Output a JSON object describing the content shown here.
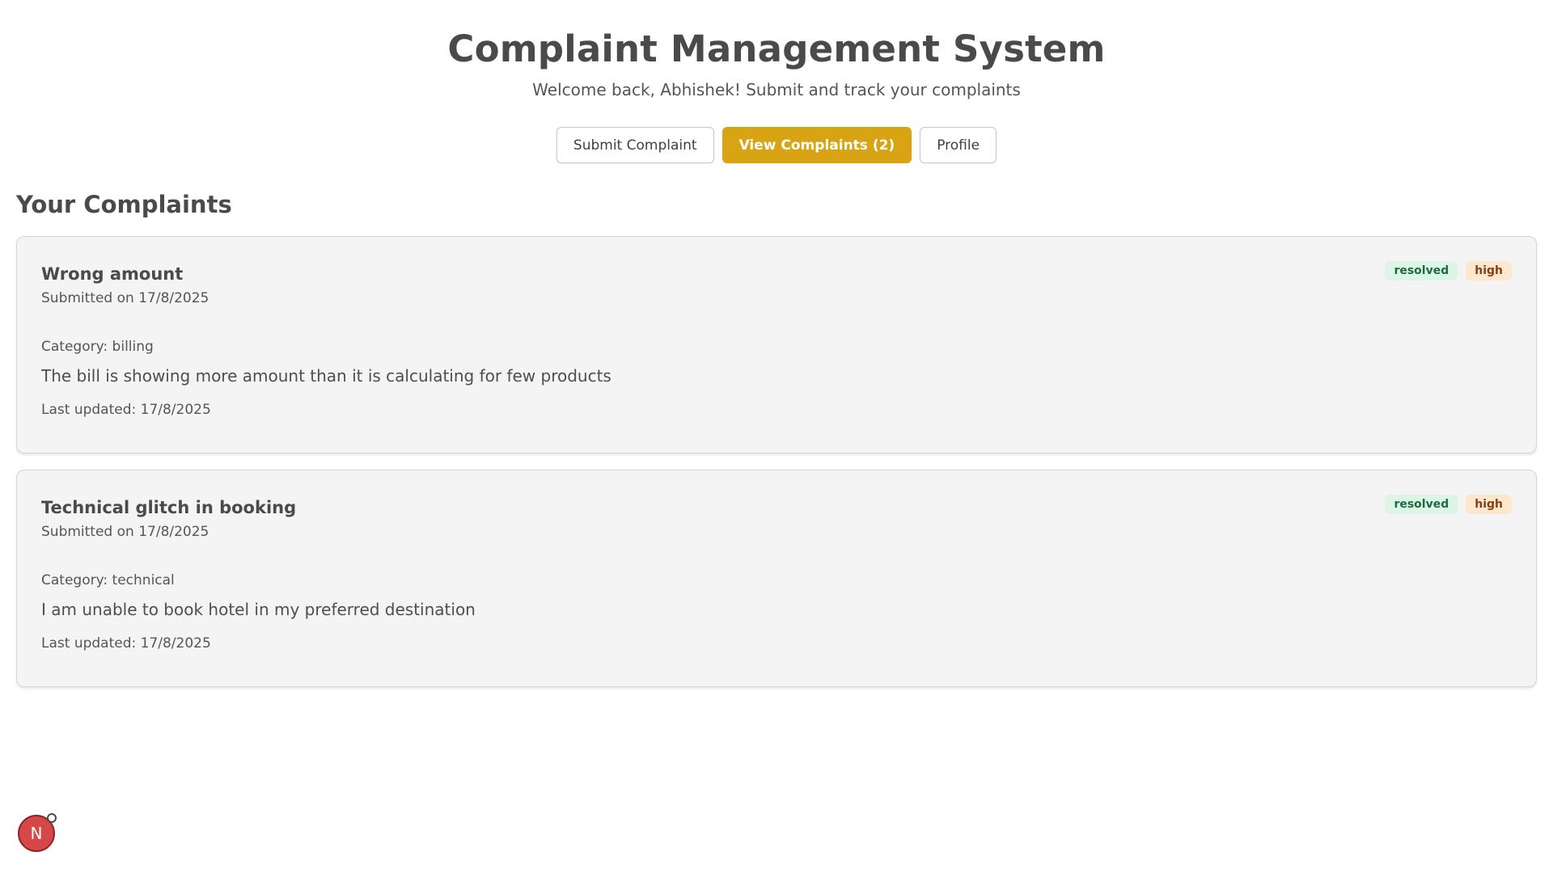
{
  "header": {
    "title": "Complaint Management System",
    "subtitle": "Welcome back, Abhishek! Submit and track your complaints"
  },
  "nav": {
    "submit_label": "Submit Complaint",
    "view_label": "View Complaints (2)",
    "profile_label": "Profile",
    "active": "view"
  },
  "main": {
    "section_title": "Your Complaints",
    "complaints": [
      {
        "title": "Wrong amount",
        "submitted": "Submitted on 17/8/2025",
        "category": "Category: billing",
        "description": "The bill is showing more amount than it is calculating for few products",
        "updated": "Last updated: 17/8/2025",
        "status": "resolved",
        "priority": "high"
      },
      {
        "title": "Technical glitch in booking",
        "submitted": "Submitted on 17/8/2025",
        "category": "Category: technical",
        "description": "I am unable to book hotel in my preferred destination",
        "updated": "Last updated: 17/8/2025",
        "status": "resolved",
        "priority": "high"
      }
    ]
  },
  "devtools": {
    "badge_letter": "N",
    "icon": "nextjs-devtools-icon"
  },
  "colors": {
    "accent": "#d9a413",
    "status_bg": "#dcf5e6",
    "status_fg": "#1d6b3e",
    "priority_bg": "#fde7cf",
    "priority_fg": "#8a3d12",
    "devtools_red": "#d64848"
  }
}
